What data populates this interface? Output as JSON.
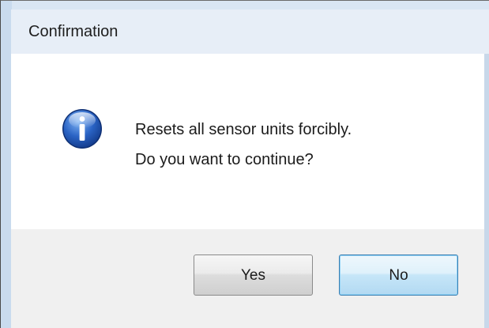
{
  "dialog": {
    "title": "Confirmation",
    "icon": "info-icon",
    "message_line1": "Resets all sensor units forcibly.",
    "message_line2": "Do you want to continue?",
    "yes_label": "Yes",
    "no_label": "No",
    "default_button": "No"
  },
  "colors": {
    "title_bar": "#e7eef7",
    "content_bg": "#ffffff",
    "button_area_bg": "#f0f0f0",
    "icon_blue": "#2a63c4",
    "focus_border": "#3c7fb1"
  }
}
